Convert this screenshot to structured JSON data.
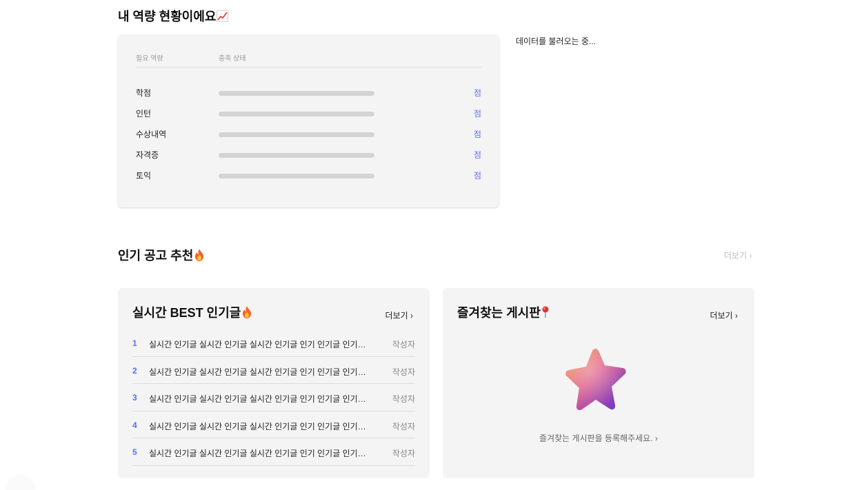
{
  "competency": {
    "title": "내 역량 현황이에요",
    "title_icon": "chart-up-emoji",
    "head_required": "필요 역량",
    "head_status": "충족 상태",
    "rows": [
      {
        "label": "학점",
        "score": "점",
        "progress": 0
      },
      {
        "label": "인턴",
        "score": "점",
        "progress": 0
      },
      {
        "label": "수상내역",
        "score": "점",
        "progress": 0
      },
      {
        "label": "자격증",
        "score": "점",
        "progress": 0
      },
      {
        "label": "토익",
        "score": "점",
        "progress": 0
      }
    ]
  },
  "loading_text": "데이터를 불러오는 중...",
  "popular": {
    "title": "인기 공고 추천",
    "title_icon": "fire-emoji",
    "more_label": "더보기 ›"
  },
  "best": {
    "title": "실시간 BEST 인기글",
    "title_icon": "fire-emoji",
    "more_label": "더보기 ›",
    "items": [
      {
        "rank": "1",
        "text": "실시간 인기글 실시간 인기글 실시간 인기글 인기 인기글 인기 인기글 인기",
        "author": "작성자"
      },
      {
        "rank": "2",
        "text": "실시간 인기글 실시간 인기글 실시간 인기글 인기 인기글 인기 인기글 인기",
        "author": "작성자"
      },
      {
        "rank": "3",
        "text": "실시간 인기글 실시간 인기글 실시간 인기글 인기 인기글 인기 인기글 인기",
        "author": "작성자"
      },
      {
        "rank": "4",
        "text": "실시간 인기글 실시간 인기글 실시간 인기글 인기 인기글 인기 인기글 인기",
        "author": "작성자"
      },
      {
        "rank": "5",
        "text": "실시간 인기글 실시간 인기글 실시간 인기글 인기 인기글 인기 인기글 인기",
        "author": "작성자"
      }
    ]
  },
  "favorites": {
    "title": "즐겨찾는 게시판",
    "title_icon": "pin-emoji",
    "more_label": "더보기 ›",
    "empty_message": "즐겨찾는 게시판을 등록해주세요. ›",
    "illustration": "star-icon"
  },
  "colors": {
    "accent": "#5b6bff",
    "card_bg": "#f4f4f4",
    "bar_track": "#d4d4d4"
  }
}
